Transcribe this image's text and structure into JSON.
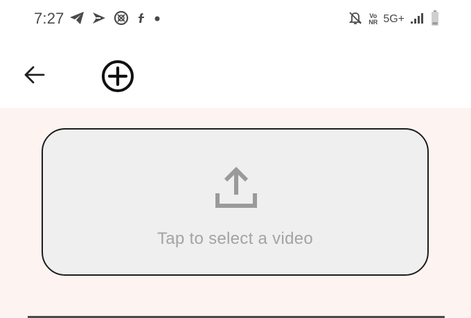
{
  "status_bar": {
    "time": "7:27",
    "left_icons": [
      "telegram-icon",
      "direct-share-icon",
      "vpn-shield-icon",
      "flipkart-icon",
      "dot-icon"
    ],
    "right_icons": [
      "mute-bell-icon",
      "volte-icon",
      "network-icon",
      "signal-icon",
      "battery-icon"
    ],
    "volte_top": "Vo",
    "volte_bottom": "NR",
    "network_label": "5G+"
  },
  "app_bar": {
    "back_icon": "arrow-back-icon",
    "add_icon": "add-circle-icon"
  },
  "video_picker": {
    "icon": "upload-icon",
    "label": "Tap to select a video"
  },
  "colors": {
    "content_background": "#fdf4f1",
    "picker_background": "#efefef",
    "picker_border": "#1c1c1c",
    "icon_gray": "#9a9a9a",
    "label_gray": "#a3a3a3"
  }
}
